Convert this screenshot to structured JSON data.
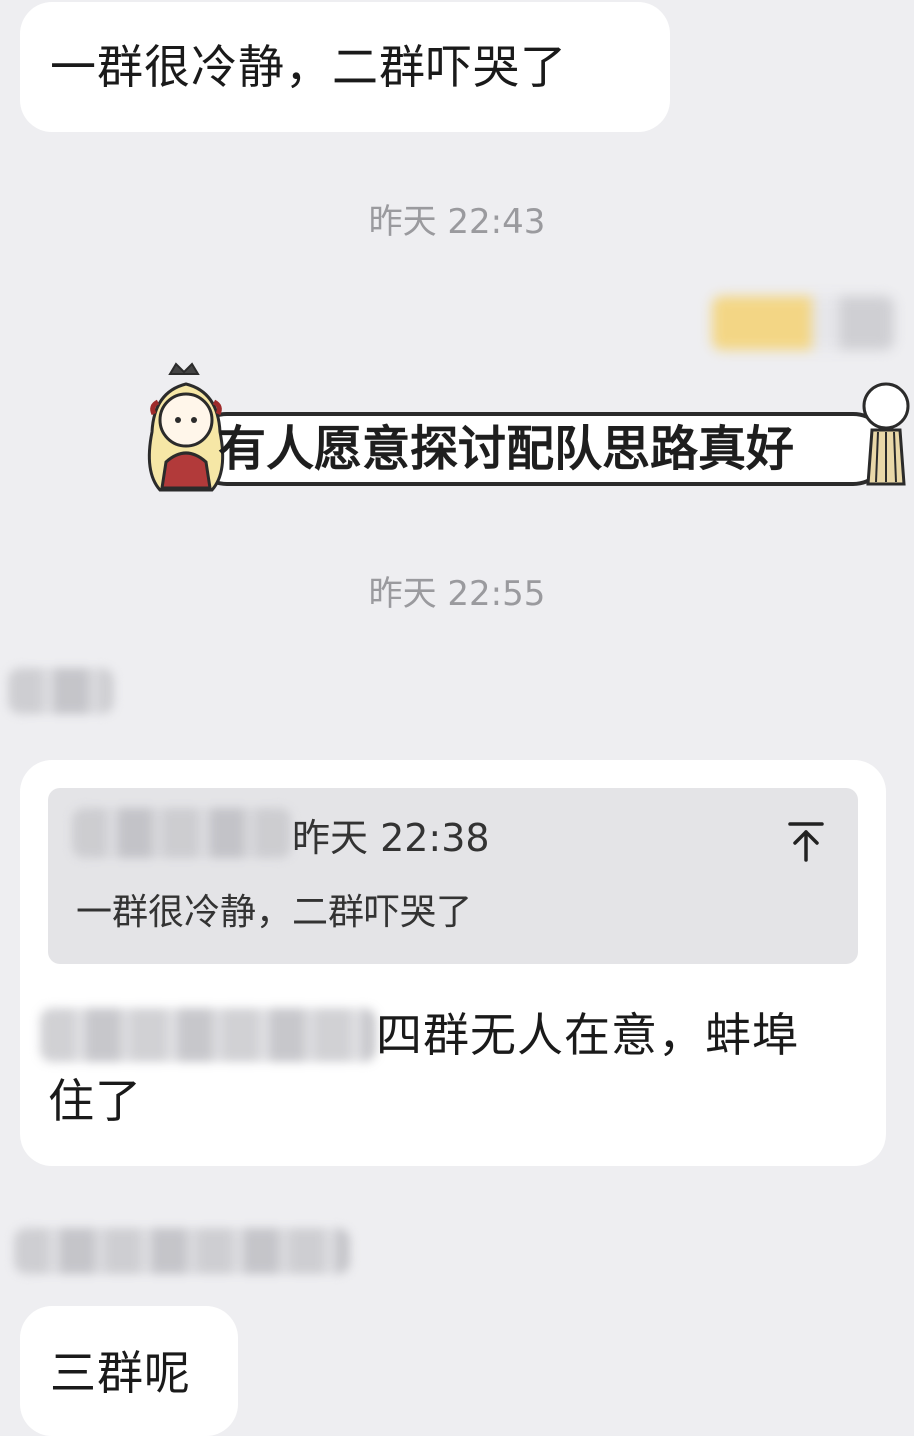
{
  "messages": {
    "m1": {
      "text": "一群很冷静，二群吓哭了"
    },
    "ts1": "昨天 22:43",
    "sticker": {
      "text": "有人愿意探讨配队思路真好"
    },
    "ts2": "昨天 22:55",
    "reply": {
      "quote_time": "昨天 22:38",
      "quote_text": "一群很冷静，二群吓哭了",
      "text_line1": "四群无人在意，蚌埠",
      "text_line2": "住了"
    },
    "m3": {
      "text": "三群呢"
    }
  },
  "icons": {
    "jump_to_quote": "arrow-up-to-top-icon"
  },
  "colors": {
    "background": "#eeeef1",
    "bubble": "#ffffff",
    "quote_bg": "#e4e4e7",
    "timestamp": "#9a9a9e"
  }
}
